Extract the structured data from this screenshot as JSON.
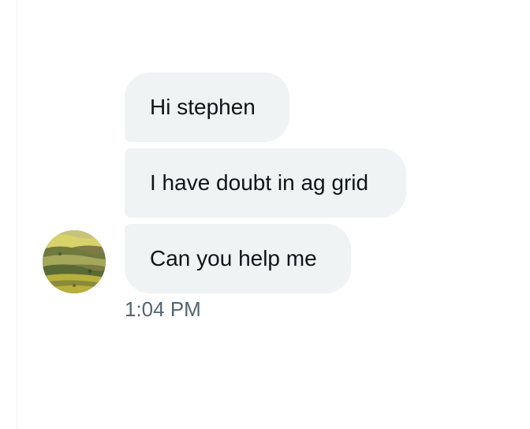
{
  "conversation": {
    "messages": [
      {
        "text": "Hi stephen"
      },
      {
        "text": "I have doubt in ag grid"
      },
      {
        "text": "Can you help me"
      }
    ],
    "timestamp": "1:04 PM",
    "avatar_icon": "landscape-avatar-icon"
  },
  "colors": {
    "bubble_background": "#eff3f4",
    "text": "#0f1419",
    "timestamp": "#536471",
    "border": "#eff3f4"
  }
}
